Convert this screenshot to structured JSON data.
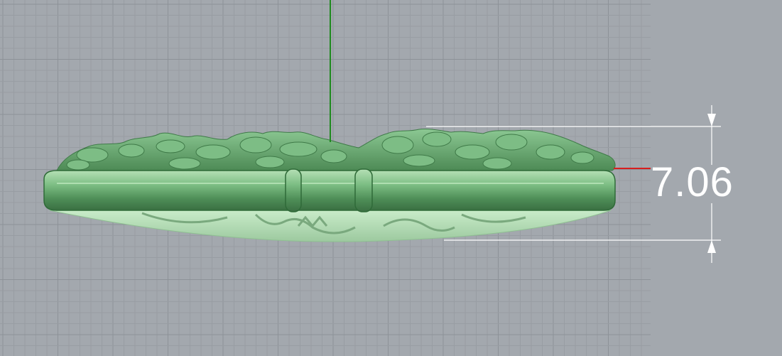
{
  "viewport": {
    "background_color": "#a3a8ae",
    "grid_minor_color": "#989da3",
    "grid_major_color": "#8d9298",
    "y_axis_color": "#1f8a1f",
    "x_axis_color": "#d81e1e"
  },
  "model": {
    "name": "pendant-model",
    "fill_color": "#6fae79",
    "highlight_color": "#a9d8a9",
    "shadow_color": "#3f7a48"
  },
  "dimension": {
    "value": "7.06",
    "line_color": "#ffffff"
  }
}
